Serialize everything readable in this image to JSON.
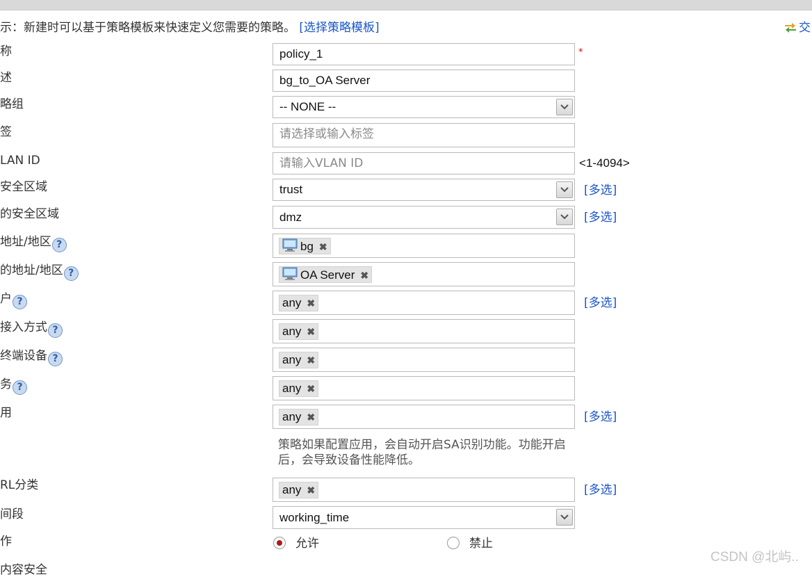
{
  "hint": {
    "text": "示：新建时可以基于策略模板来快速定义您需要的策略。",
    "link": "[选择策略模板]"
  },
  "switch_link": "交",
  "labels": {
    "name": "称",
    "desc": "述",
    "group": "略组",
    "tag": "签",
    "vlan": "LAN ID",
    "src_zone": "安全区域",
    "dst_zone": "的安全区域",
    "src_addr": "地址/地区",
    "dst_addr": "的地址/地区",
    "user": "户",
    "access": "接入方式",
    "terminal": "终端设备",
    "service": "务",
    "app": "用",
    "url": "RL分类",
    "time": "间段",
    "action": "作",
    "bottom_cut": "内容安全"
  },
  "fields": {
    "name": "policy_1",
    "desc": "bg_to_OA Server",
    "group": "-- NONE --",
    "tag_placeholder": "请选择或输入标签",
    "vlan_placeholder": "请输入VLAN ID",
    "vlan_range": "<1-4094>",
    "src_zone": "trust",
    "dst_zone": "dmz",
    "src_addr_tag": "bg",
    "dst_addr_tag": "OA Server",
    "user_tag": "any",
    "access_tag": "any",
    "terminal_tag": "any",
    "service_tag": "any",
    "app_tag": "any",
    "url_tag": "any",
    "time": "working_time"
  },
  "multi_label": "[多选]",
  "required_mark": "*",
  "help_glyph": "?",
  "remove_glyph": "✖",
  "note": "策略如果配置应用，会自动开启SA识别功能。功能开启后，会导致设备性能降低。",
  "action": {
    "allow": "允许",
    "deny": "禁止",
    "selected": "allow"
  },
  "watermark": "CSDN @北屿..",
  "colors": {
    "link": "#1a55c8",
    "required": "#e00000",
    "radio_selected": "#b01818"
  }
}
